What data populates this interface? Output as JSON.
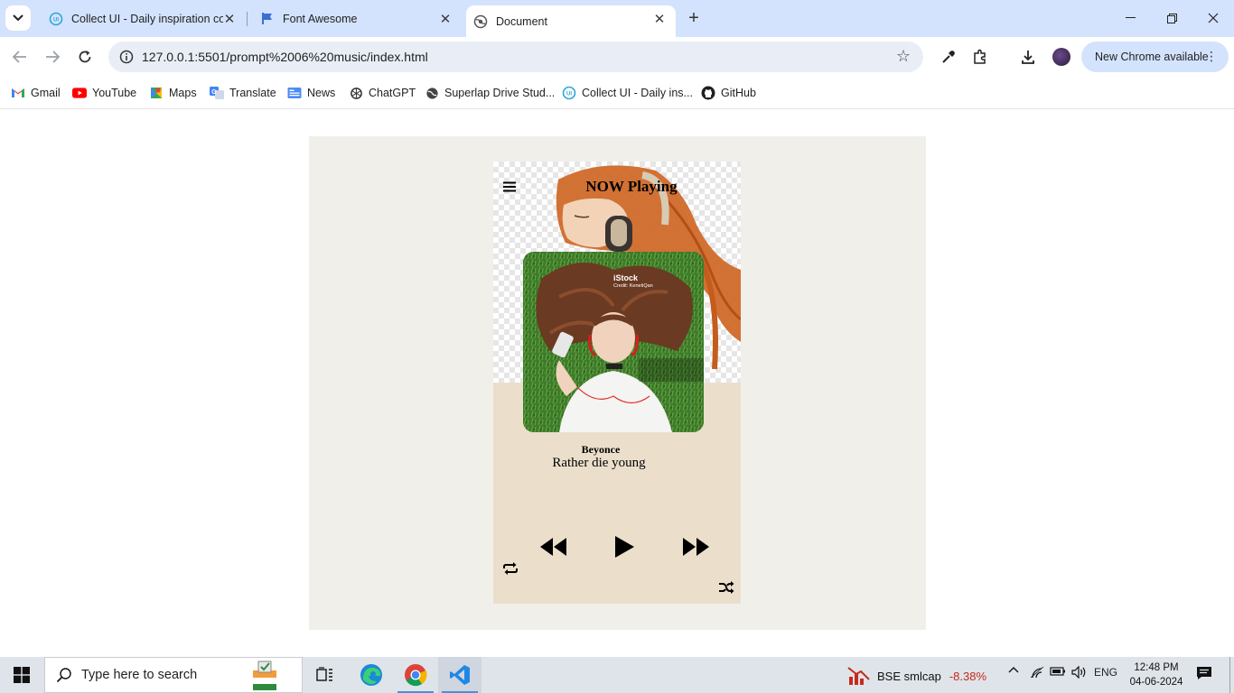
{
  "browser": {
    "tabs": [
      {
        "title": "Collect UI - Daily inspiration col",
        "icon": "collectui-icon"
      },
      {
        "title": "Font Awesome",
        "icon": "fontawesome-flag-icon"
      },
      {
        "title": "Document",
        "icon": "globe-icon"
      }
    ],
    "url": "127.0.0.1:5501/prompt%2006%20music/index.html",
    "new_chrome_label": "New Chrome available",
    "bookmarks": [
      {
        "label": "Gmail",
        "icon": "gmail-icon"
      },
      {
        "label": "YouTube",
        "icon": "youtube-icon"
      },
      {
        "label": "Maps",
        "icon": "maps-icon"
      },
      {
        "label": "Translate",
        "icon": "translate-icon"
      },
      {
        "label": "News",
        "icon": "news-icon"
      },
      {
        "label": "ChatGPT",
        "icon": "chatgpt-icon"
      },
      {
        "label": "Superlap Drive Stud...",
        "icon": "globe-icon"
      },
      {
        "label": "Collect UI - Daily ins...",
        "icon": "collectui-icon"
      },
      {
        "label": "GitHub",
        "icon": "github-icon"
      }
    ]
  },
  "player": {
    "heading": "NOW Playing",
    "artist": "Beyonce",
    "song": "Rather die young",
    "cover_watermark": "iStock",
    "cover_credit": "Credit: KenetiQan",
    "controls": [
      "menu-icon",
      "backward-icon",
      "play-icon",
      "forward-icon",
      "repeat-icon",
      "shuffle-icon"
    ],
    "colors": {
      "stage": "#f1efea",
      "card": "#ebdfcc"
    }
  },
  "taskbar": {
    "search_placeholder": "Type here to search",
    "stock_name": "BSE smlcap",
    "stock_change": "-8.38%",
    "language": "ENG",
    "time": "12:48 PM",
    "date": "04-06-2024"
  }
}
